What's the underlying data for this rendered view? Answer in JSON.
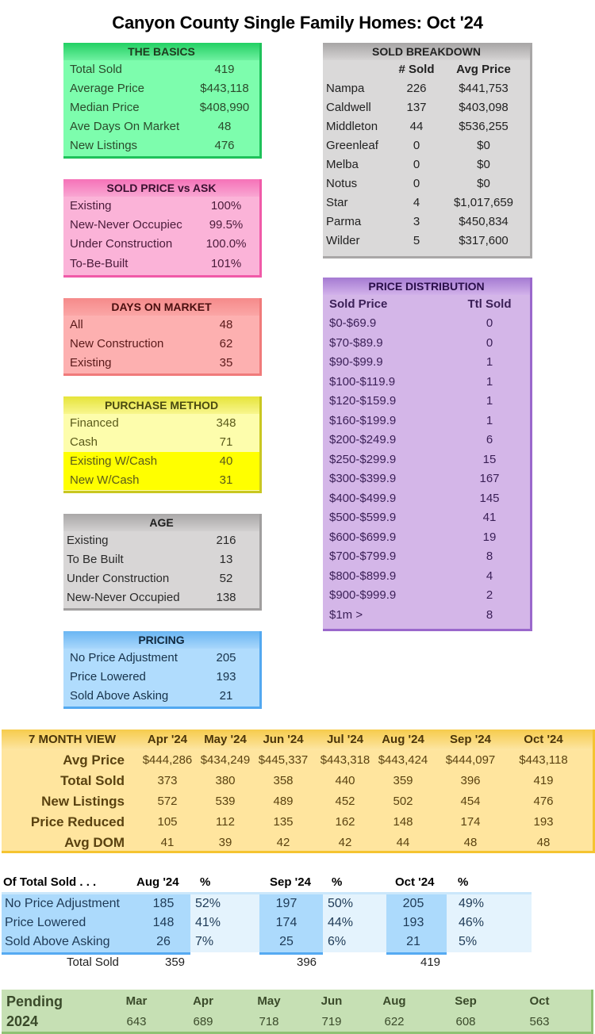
{
  "title": "Canyon County Single Family Homes: Oct '24",
  "basics": {
    "header": "THE BASICS",
    "rows": [
      {
        "label": "Total Sold",
        "value": "419"
      },
      {
        "label": "Average Price",
        "value": "$443,118"
      },
      {
        "label": "Median Price",
        "value": "$408,990"
      },
      {
        "label": "Ave Days On Market",
        "value": "48"
      },
      {
        "label": "New Listings",
        "value": "476"
      }
    ]
  },
  "sold_vs_ask": {
    "header": "SOLD PRICE vs ASK",
    "rows": [
      {
        "label": "Existing",
        "value": "100%"
      },
      {
        "label": "New-Never Occupiec",
        "value": "99.5%"
      },
      {
        "label": "Under Construction",
        "value": "100.0%"
      },
      {
        "label": "To-Be-Built",
        "value": "101%"
      }
    ]
  },
  "days_on_market": {
    "header": "DAYS ON MARKET",
    "rows": [
      {
        "label": "All",
        "value": "48"
      },
      {
        "label": "New Construction",
        "value": "62"
      },
      {
        "label": "Existing",
        "value": "35"
      }
    ]
  },
  "purchase_method": {
    "header": "PURCHASE METHOD",
    "rows": [
      {
        "label": "Financed",
        "value": "348"
      },
      {
        "label": "Cash",
        "value": "71"
      },
      {
        "label": "Existing W/Cash",
        "value": "40"
      },
      {
        "label": "New W/Cash",
        "value": "31"
      }
    ]
  },
  "age": {
    "header": "AGE",
    "rows": [
      {
        "label": "Existing",
        "value": "216"
      },
      {
        "label": "To Be Built",
        "value": "13"
      },
      {
        "label": "Under Construction",
        "value": "52"
      },
      {
        "label": "New-Never Occupied",
        "value": "138"
      }
    ]
  },
  "pricing": {
    "header": "PRICING",
    "rows": [
      {
        "label": "No Price Adjustment",
        "value": "205"
      },
      {
        "label": "Price Lowered",
        "value": "193"
      },
      {
        "label": "Sold Above Asking",
        "value": "21"
      }
    ]
  },
  "sold_breakdown": {
    "header": "SOLD BREAKDOWN",
    "col_sold": "# Sold",
    "col_avg": "Avg Price",
    "rows": [
      {
        "city": "Nampa",
        "sold": "226",
        "avg": "$441,753"
      },
      {
        "city": "Caldwell",
        "sold": "137",
        "avg": "$403,098"
      },
      {
        "city": "Middleton",
        "sold": "44",
        "avg": "$536,255"
      },
      {
        "city": "Greenleaf",
        "sold": "0",
        "avg": "$0"
      },
      {
        "city": "Melba",
        "sold": "0",
        "avg": "$0"
      },
      {
        "city": "Notus",
        "sold": "0",
        "avg": "$0"
      },
      {
        "city": "Star",
        "sold": "4",
        "avg": "$1,017,659"
      },
      {
        "city": "Parma",
        "sold": "3",
        "avg": "$450,834"
      },
      {
        "city": "Wilder",
        "sold": "5",
        "avg": "$317,600"
      }
    ]
  },
  "price_distribution": {
    "header": "PRICE DISTRIBUTION",
    "col_price": "Sold Price",
    "col_total": "Ttl Sold",
    "rows": [
      {
        "range": "$0-$69.9",
        "total": "0"
      },
      {
        "range": "$70-$89.9",
        "total": "0"
      },
      {
        "range": "$90-$99.9",
        "total": "1"
      },
      {
        "range": "$100-$119.9",
        "total": "1"
      },
      {
        "range": "$120-$159.9",
        "total": "1"
      },
      {
        "range": "$160-$199.9",
        "total": "1"
      },
      {
        "range": "$200-$249.9",
        "total": "6"
      },
      {
        "range": "$250-$299.9",
        "total": "15"
      },
      {
        "range": "$300-$399.9",
        "total": "167"
      },
      {
        "range": "$400-$499.9",
        "total": "145"
      },
      {
        "range": "$500-$599.9",
        "total": "41"
      },
      {
        "range": "$600-$699.9",
        "total": "19"
      },
      {
        "range": "$700-$799.9",
        "total": "8"
      },
      {
        "range": "$800-$899.9",
        "total": "4"
      },
      {
        "range": "$900-$999.9",
        "total": "2"
      },
      {
        "range": "$1m >",
        "total": "8"
      }
    ]
  },
  "seven_month": {
    "header": "7 MONTH VIEW",
    "months": [
      "Apr '24",
      "May '24",
      "Jun '24",
      "Jul '24",
      "Aug '24",
      "Sep '24",
      "Oct '24"
    ],
    "rows": [
      {
        "label": "Avg Price",
        "values": [
          "$444,286",
          "$434,249",
          "$445,337",
          "$443,318",
          "$443,424",
          "$444,097",
          "$443,118"
        ]
      },
      {
        "label": "Total Sold",
        "values": [
          "373",
          "380",
          "358",
          "440",
          "359",
          "396",
          "419"
        ]
      },
      {
        "label": "New Listings",
        "values": [
          "572",
          "539",
          "489",
          "452",
          "502",
          "454",
          "476"
        ]
      },
      {
        "label": "Price Reduced",
        "values": [
          "105",
          "112",
          "135",
          "162",
          "148",
          "174",
          "193"
        ]
      },
      {
        "label": "Avg DOM",
        "values": [
          "41",
          "39",
          "42",
          "42",
          "44",
          "48",
          "48"
        ]
      }
    ]
  },
  "of_total_sold": {
    "header": "Of Total Sold . . .",
    "pct_label": "%",
    "periods": [
      "Aug '24",
      "Sep '24",
      "Oct '24"
    ],
    "rows": [
      {
        "label": "No Price Adjustment",
        "values": [
          [
            "185",
            "52%"
          ],
          [
            "197",
            "50%"
          ],
          [
            "205",
            "49%"
          ]
        ]
      },
      {
        "label": "Price Lowered",
        "values": [
          [
            "148",
            "41%"
          ],
          [
            "174",
            "44%"
          ],
          [
            "193",
            "46%"
          ]
        ]
      },
      {
        "label": "Sold Above Asking",
        "values": [
          [
            "26",
            "7%"
          ],
          [
            "25",
            "6%"
          ],
          [
            "21",
            "5%"
          ]
        ]
      }
    ],
    "total_label": "Total Sold",
    "totals": [
      "359",
      "396",
      "419"
    ]
  },
  "pending": {
    "label": "Pending",
    "year": "2024",
    "months": [
      "Mar",
      "Apr",
      "May",
      "Jun",
      "Aug",
      "Sep",
      "Oct"
    ],
    "values": [
      "643",
      "689",
      "718",
      "719",
      "622",
      "608",
      "563"
    ]
  }
}
